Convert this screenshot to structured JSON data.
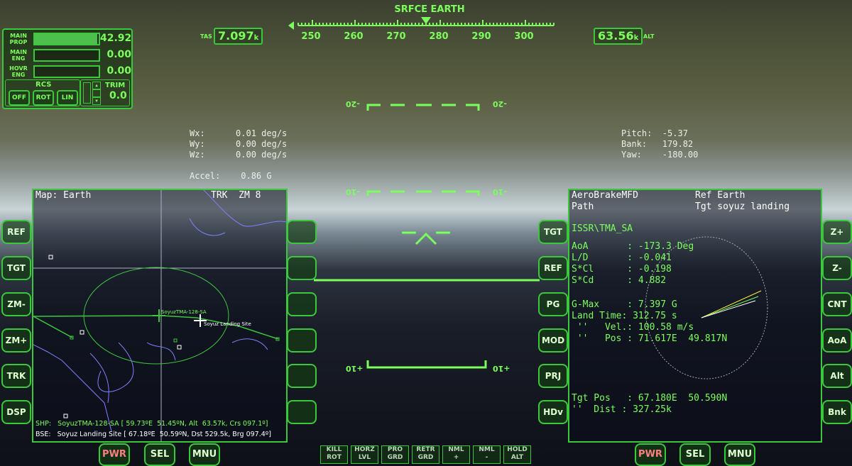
{
  "hud": {
    "mode_label": "SRFCE EARTH",
    "tas_label": "TAS",
    "tas_value": "7.097",
    "tas_unit": "k",
    "alt_label": "ALT",
    "alt_value": "63.56",
    "alt_unit": "k",
    "heading_ticks": [
      "250",
      "260",
      "270",
      "280",
      "290",
      "300"
    ],
    "pitch_ladder": {
      "top_left": "-20",
      "top_right": "-20",
      "mid_left": "-10",
      "mid_right": "-10",
      "bot_left": "+10",
      "bot_right": "+10"
    }
  },
  "engine_panel": {
    "main_prop": {
      "label": "MAIN\nPROP",
      "value": "42.92",
      "fill": 0.98
    },
    "main_eng": {
      "label": "MAIN\nENG",
      "value": "0.00"
    },
    "hovr_eng": {
      "label": "HOVR\nENG",
      "value": "0.00"
    },
    "rcs_label": "RCS",
    "rcs_buttons": [
      "OFF",
      "ROT",
      "LIN"
    ],
    "trim_label": "TRIM",
    "trim_value": "0.0"
  },
  "rates": {
    "wx": "Wx:      0.01 deg/s",
    "wy": "Wy:      0.00 deg/s",
    "wz": "Wz:      0.00 deg/s",
    "accel": "Accel:    0.86 G"
  },
  "attitude": {
    "pitch": "Pitch:  -5.37",
    "bank": "Bank:   179.82",
    "yaw": "Yaw:    -180.00"
  },
  "left_mfd": {
    "title": "Map: Earth",
    "mode": "TRK  ZM 8",
    "ship_label": "SoyuzTMA-128-SA",
    "site_label": "Soyuz Landing Site",
    "shp_line": "SHP:   SoyuzTMA-128-SA [ 59.73ºE  51.45ºN, Alt  63.57k, Crs 097.1º]",
    "bse_line": "BSE:   Soyuz Landing Site [ 67.18ºE  50.59ºN, Dst 529.5k, Brg 097.4º]",
    "left_buttons": [
      "REF",
      "TGT",
      "ZM-",
      "ZM+",
      "TRK",
      "DSP"
    ],
    "bottom_buttons": [
      "PWR",
      "SEL",
      "MNU"
    ]
  },
  "right_mfd": {
    "title": "AeroBrakeMFD",
    "subtitle": "Path",
    "ref": "Ref Earth",
    "tgt": "Tgt soyuz landing",
    "vessel": "ISSR\\TMA_SA",
    "lines": [
      "AoA       : -173.3 Deg",
      "L/D       : -0.041",
      "S*Cl      : -0.198",
      "S*Cd      : 4.882",
      "",
      "G-Max     : 7.397 G",
      "Land Time: 312.75 s",
      " ''   Vel.: 100.58 m/s",
      " ''   Pos : 71.617E  49.817N"
    ],
    "tgt_pos": "Tgt Pos   : 67.180E  50.590N",
    "tgt_dist": "''  Dist : 327.25k",
    "left_buttons": [
      "TGT",
      "REF",
      "PG",
      "MOD",
      "PRJ",
      "HDv"
    ],
    "right_buttons": [
      "Z+",
      "Z-",
      "CNT",
      "AoA",
      "Alt",
      "Bnk"
    ],
    "bottom_buttons": [
      "PWR",
      "SEL",
      "MNU"
    ]
  },
  "nav_buttons": [
    {
      "top": "KILL",
      "bottom": "ROT"
    },
    {
      "top": "HORZ",
      "bottom": "LVL"
    },
    {
      "top": "PRO",
      "bottom": "GRD"
    },
    {
      "top": "RETR",
      "bottom": "GRD"
    },
    {
      "top": "NML",
      "bottom": "+"
    },
    {
      "top": "NML",
      "bottom": "-"
    },
    {
      "top": "HOLD",
      "bottom": "ALT"
    }
  ],
  "colors": {
    "hud_green": "#7cff5c",
    "frame_green": "#3cc83c",
    "map_line": "#8080ff"
  }
}
